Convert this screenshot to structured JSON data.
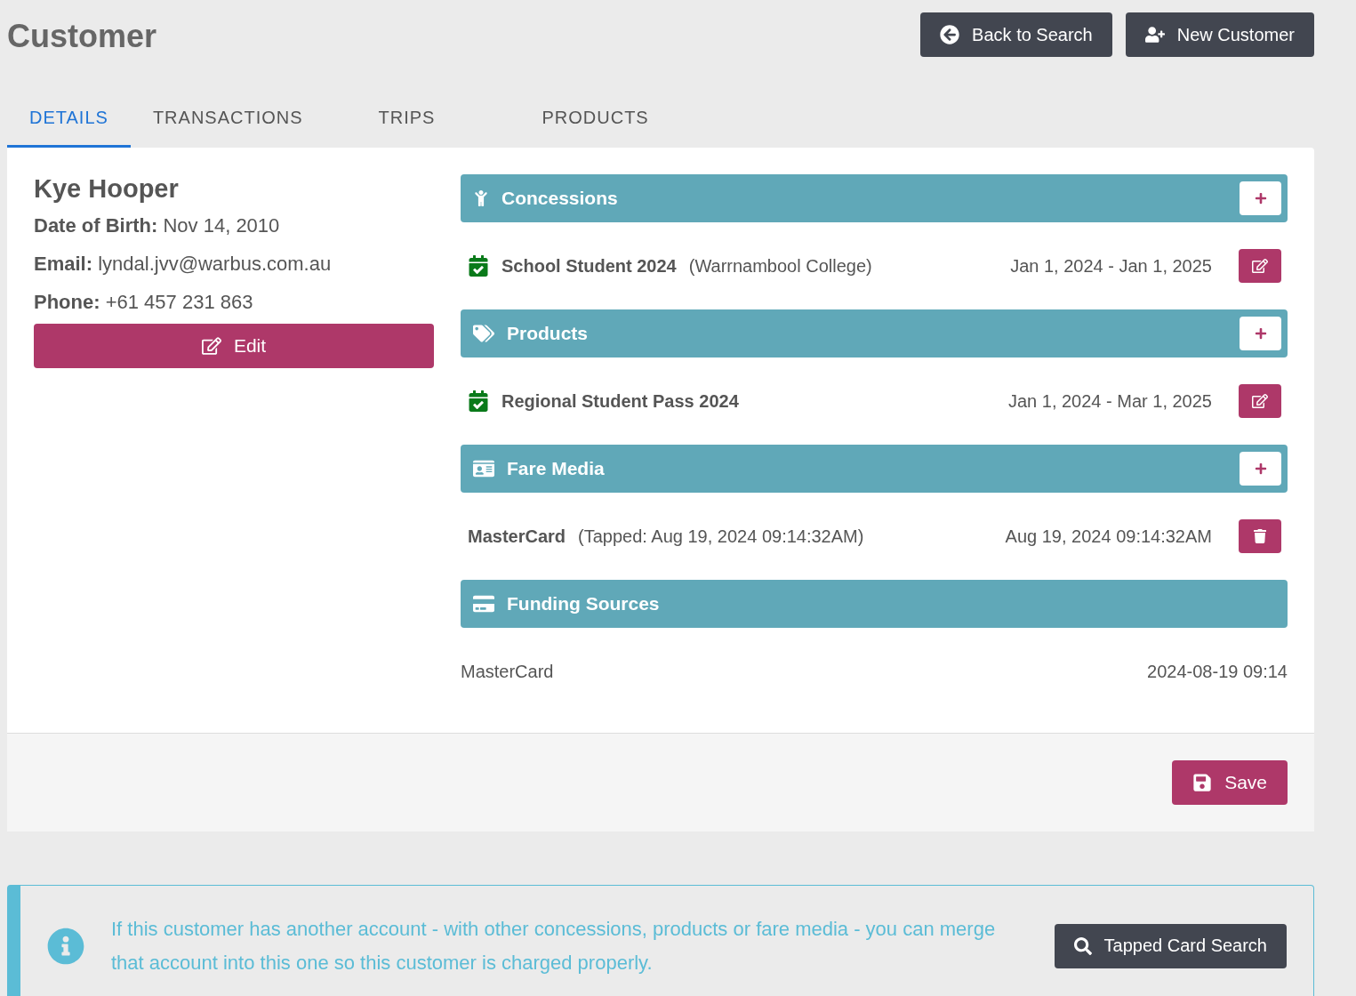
{
  "header": {
    "title": "Customer",
    "buttons": [
      {
        "kind": "back",
        "label": "Back to Search"
      },
      {
        "kind": "add_user",
        "label": "New Customer"
      }
    ]
  },
  "tabs": [
    {
      "label": "DETAILS",
      "selected": true
    },
    {
      "label": "TRANSACTIONS",
      "selected": false
    },
    {
      "label": "TRIPS",
      "selected": false
    },
    {
      "label": "PRODUCTS",
      "selected": false
    }
  ],
  "customer": {
    "name": "Kye Hooper",
    "fields": [
      {
        "label": "Date of Birth:",
        "value": "Nov 14, 2010"
      },
      {
        "label": "Email:",
        "value": "lyndal.jvv@warbus.com.au"
      },
      {
        "label": "Phone:",
        "value": "+61 457 231 863"
      }
    ],
    "edit_button": "Edit"
  },
  "sections": [
    {
      "kind": "person",
      "title": "Concessions",
      "addable": true,
      "items": [
        {
          "kind": "pass",
          "name": "School Student 2024",
          "note": "(Warrnambool College)",
          "date": "Jan 1, 2024 - Jan 1, 2025"
        }
      ]
    },
    {
      "kind": "tags",
      "title": "Products",
      "addable": true,
      "items": [
        {
          "kind": "pass",
          "name": "Regional Student Pass 2024",
          "date": "Jan 1, 2024 - Mar 1, 2025"
        }
      ]
    },
    {
      "kind": "idcard",
      "title": "Fare Media",
      "addable": true,
      "items": [
        {
          "kind": "media",
          "name": "MasterCard",
          "note": "(Tapped: Aug 19, 2024 09:14:32AM)",
          "date": "Aug 19, 2024 09:14:32AM"
        }
      ]
    },
    {
      "kind": "card",
      "title": "Funding Sources",
      "addable": false,
      "items": [
        {
          "kind": "source",
          "name": "MasterCard",
          "date": "2024-08-19 09:14"
        }
      ]
    }
  ],
  "save_button": "Save",
  "info": {
    "message": "If this customer has another account - with other concessions, products or fare media - you can merge that account into this one so this customer is charged properly.",
    "button": "Tapped Card Search"
  }
}
